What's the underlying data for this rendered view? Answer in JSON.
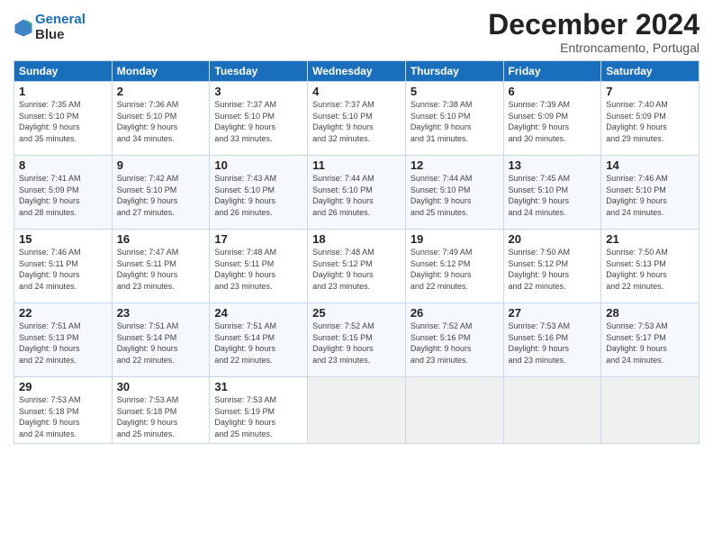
{
  "header": {
    "logo_line1": "General",
    "logo_line2": "Blue",
    "month": "December 2024",
    "location": "Entroncamento, Portugal"
  },
  "weekdays": [
    "Sunday",
    "Monday",
    "Tuesday",
    "Wednesday",
    "Thursday",
    "Friday",
    "Saturday"
  ],
  "weeks": [
    [
      {
        "day": "1",
        "info": "Sunrise: 7:35 AM\nSunset: 5:10 PM\nDaylight: 9 hours\nand 35 minutes."
      },
      {
        "day": "2",
        "info": "Sunrise: 7:36 AM\nSunset: 5:10 PM\nDaylight: 9 hours\nand 34 minutes."
      },
      {
        "day": "3",
        "info": "Sunrise: 7:37 AM\nSunset: 5:10 PM\nDaylight: 9 hours\nand 33 minutes."
      },
      {
        "day": "4",
        "info": "Sunrise: 7:37 AM\nSunset: 5:10 PM\nDaylight: 9 hours\nand 32 minutes."
      },
      {
        "day": "5",
        "info": "Sunrise: 7:38 AM\nSunset: 5:10 PM\nDaylight: 9 hours\nand 31 minutes."
      },
      {
        "day": "6",
        "info": "Sunrise: 7:39 AM\nSunset: 5:09 PM\nDaylight: 9 hours\nand 30 minutes."
      },
      {
        "day": "7",
        "info": "Sunrise: 7:40 AM\nSunset: 5:09 PM\nDaylight: 9 hours\nand 29 minutes."
      }
    ],
    [
      {
        "day": "8",
        "info": "Sunrise: 7:41 AM\nSunset: 5:09 PM\nDaylight: 9 hours\nand 28 minutes."
      },
      {
        "day": "9",
        "info": "Sunrise: 7:42 AM\nSunset: 5:10 PM\nDaylight: 9 hours\nand 27 minutes."
      },
      {
        "day": "10",
        "info": "Sunrise: 7:43 AM\nSunset: 5:10 PM\nDaylight: 9 hours\nand 26 minutes."
      },
      {
        "day": "11",
        "info": "Sunrise: 7:44 AM\nSunset: 5:10 PM\nDaylight: 9 hours\nand 26 minutes."
      },
      {
        "day": "12",
        "info": "Sunrise: 7:44 AM\nSunset: 5:10 PM\nDaylight: 9 hours\nand 25 minutes."
      },
      {
        "day": "13",
        "info": "Sunrise: 7:45 AM\nSunset: 5:10 PM\nDaylight: 9 hours\nand 24 minutes."
      },
      {
        "day": "14",
        "info": "Sunrise: 7:46 AM\nSunset: 5:10 PM\nDaylight: 9 hours\nand 24 minutes."
      }
    ],
    [
      {
        "day": "15",
        "info": "Sunrise: 7:46 AM\nSunset: 5:11 PM\nDaylight: 9 hours\nand 24 minutes."
      },
      {
        "day": "16",
        "info": "Sunrise: 7:47 AM\nSunset: 5:11 PM\nDaylight: 9 hours\nand 23 minutes."
      },
      {
        "day": "17",
        "info": "Sunrise: 7:48 AM\nSunset: 5:11 PM\nDaylight: 9 hours\nand 23 minutes."
      },
      {
        "day": "18",
        "info": "Sunrise: 7:48 AM\nSunset: 5:12 PM\nDaylight: 9 hours\nand 23 minutes."
      },
      {
        "day": "19",
        "info": "Sunrise: 7:49 AM\nSunset: 5:12 PM\nDaylight: 9 hours\nand 22 minutes."
      },
      {
        "day": "20",
        "info": "Sunrise: 7:50 AM\nSunset: 5:12 PM\nDaylight: 9 hours\nand 22 minutes."
      },
      {
        "day": "21",
        "info": "Sunrise: 7:50 AM\nSunset: 5:13 PM\nDaylight: 9 hours\nand 22 minutes."
      }
    ],
    [
      {
        "day": "22",
        "info": "Sunrise: 7:51 AM\nSunset: 5:13 PM\nDaylight: 9 hours\nand 22 minutes."
      },
      {
        "day": "23",
        "info": "Sunrise: 7:51 AM\nSunset: 5:14 PM\nDaylight: 9 hours\nand 22 minutes."
      },
      {
        "day": "24",
        "info": "Sunrise: 7:51 AM\nSunset: 5:14 PM\nDaylight: 9 hours\nand 22 minutes."
      },
      {
        "day": "25",
        "info": "Sunrise: 7:52 AM\nSunset: 5:15 PM\nDaylight: 9 hours\nand 23 minutes."
      },
      {
        "day": "26",
        "info": "Sunrise: 7:52 AM\nSunset: 5:16 PM\nDaylight: 9 hours\nand 23 minutes."
      },
      {
        "day": "27",
        "info": "Sunrise: 7:53 AM\nSunset: 5:16 PM\nDaylight: 9 hours\nand 23 minutes."
      },
      {
        "day": "28",
        "info": "Sunrise: 7:53 AM\nSunset: 5:17 PM\nDaylight: 9 hours\nand 24 minutes."
      }
    ],
    [
      {
        "day": "29",
        "info": "Sunrise: 7:53 AM\nSunset: 5:18 PM\nDaylight: 9 hours\nand 24 minutes."
      },
      {
        "day": "30",
        "info": "Sunrise: 7:53 AM\nSunset: 5:18 PM\nDaylight: 9 hours\nand 25 minutes."
      },
      {
        "day": "31",
        "info": "Sunrise: 7:53 AM\nSunset: 5:19 PM\nDaylight: 9 hours\nand 25 minutes."
      },
      {
        "day": "",
        "info": ""
      },
      {
        "day": "",
        "info": ""
      },
      {
        "day": "",
        "info": ""
      },
      {
        "day": "",
        "info": ""
      }
    ]
  ]
}
